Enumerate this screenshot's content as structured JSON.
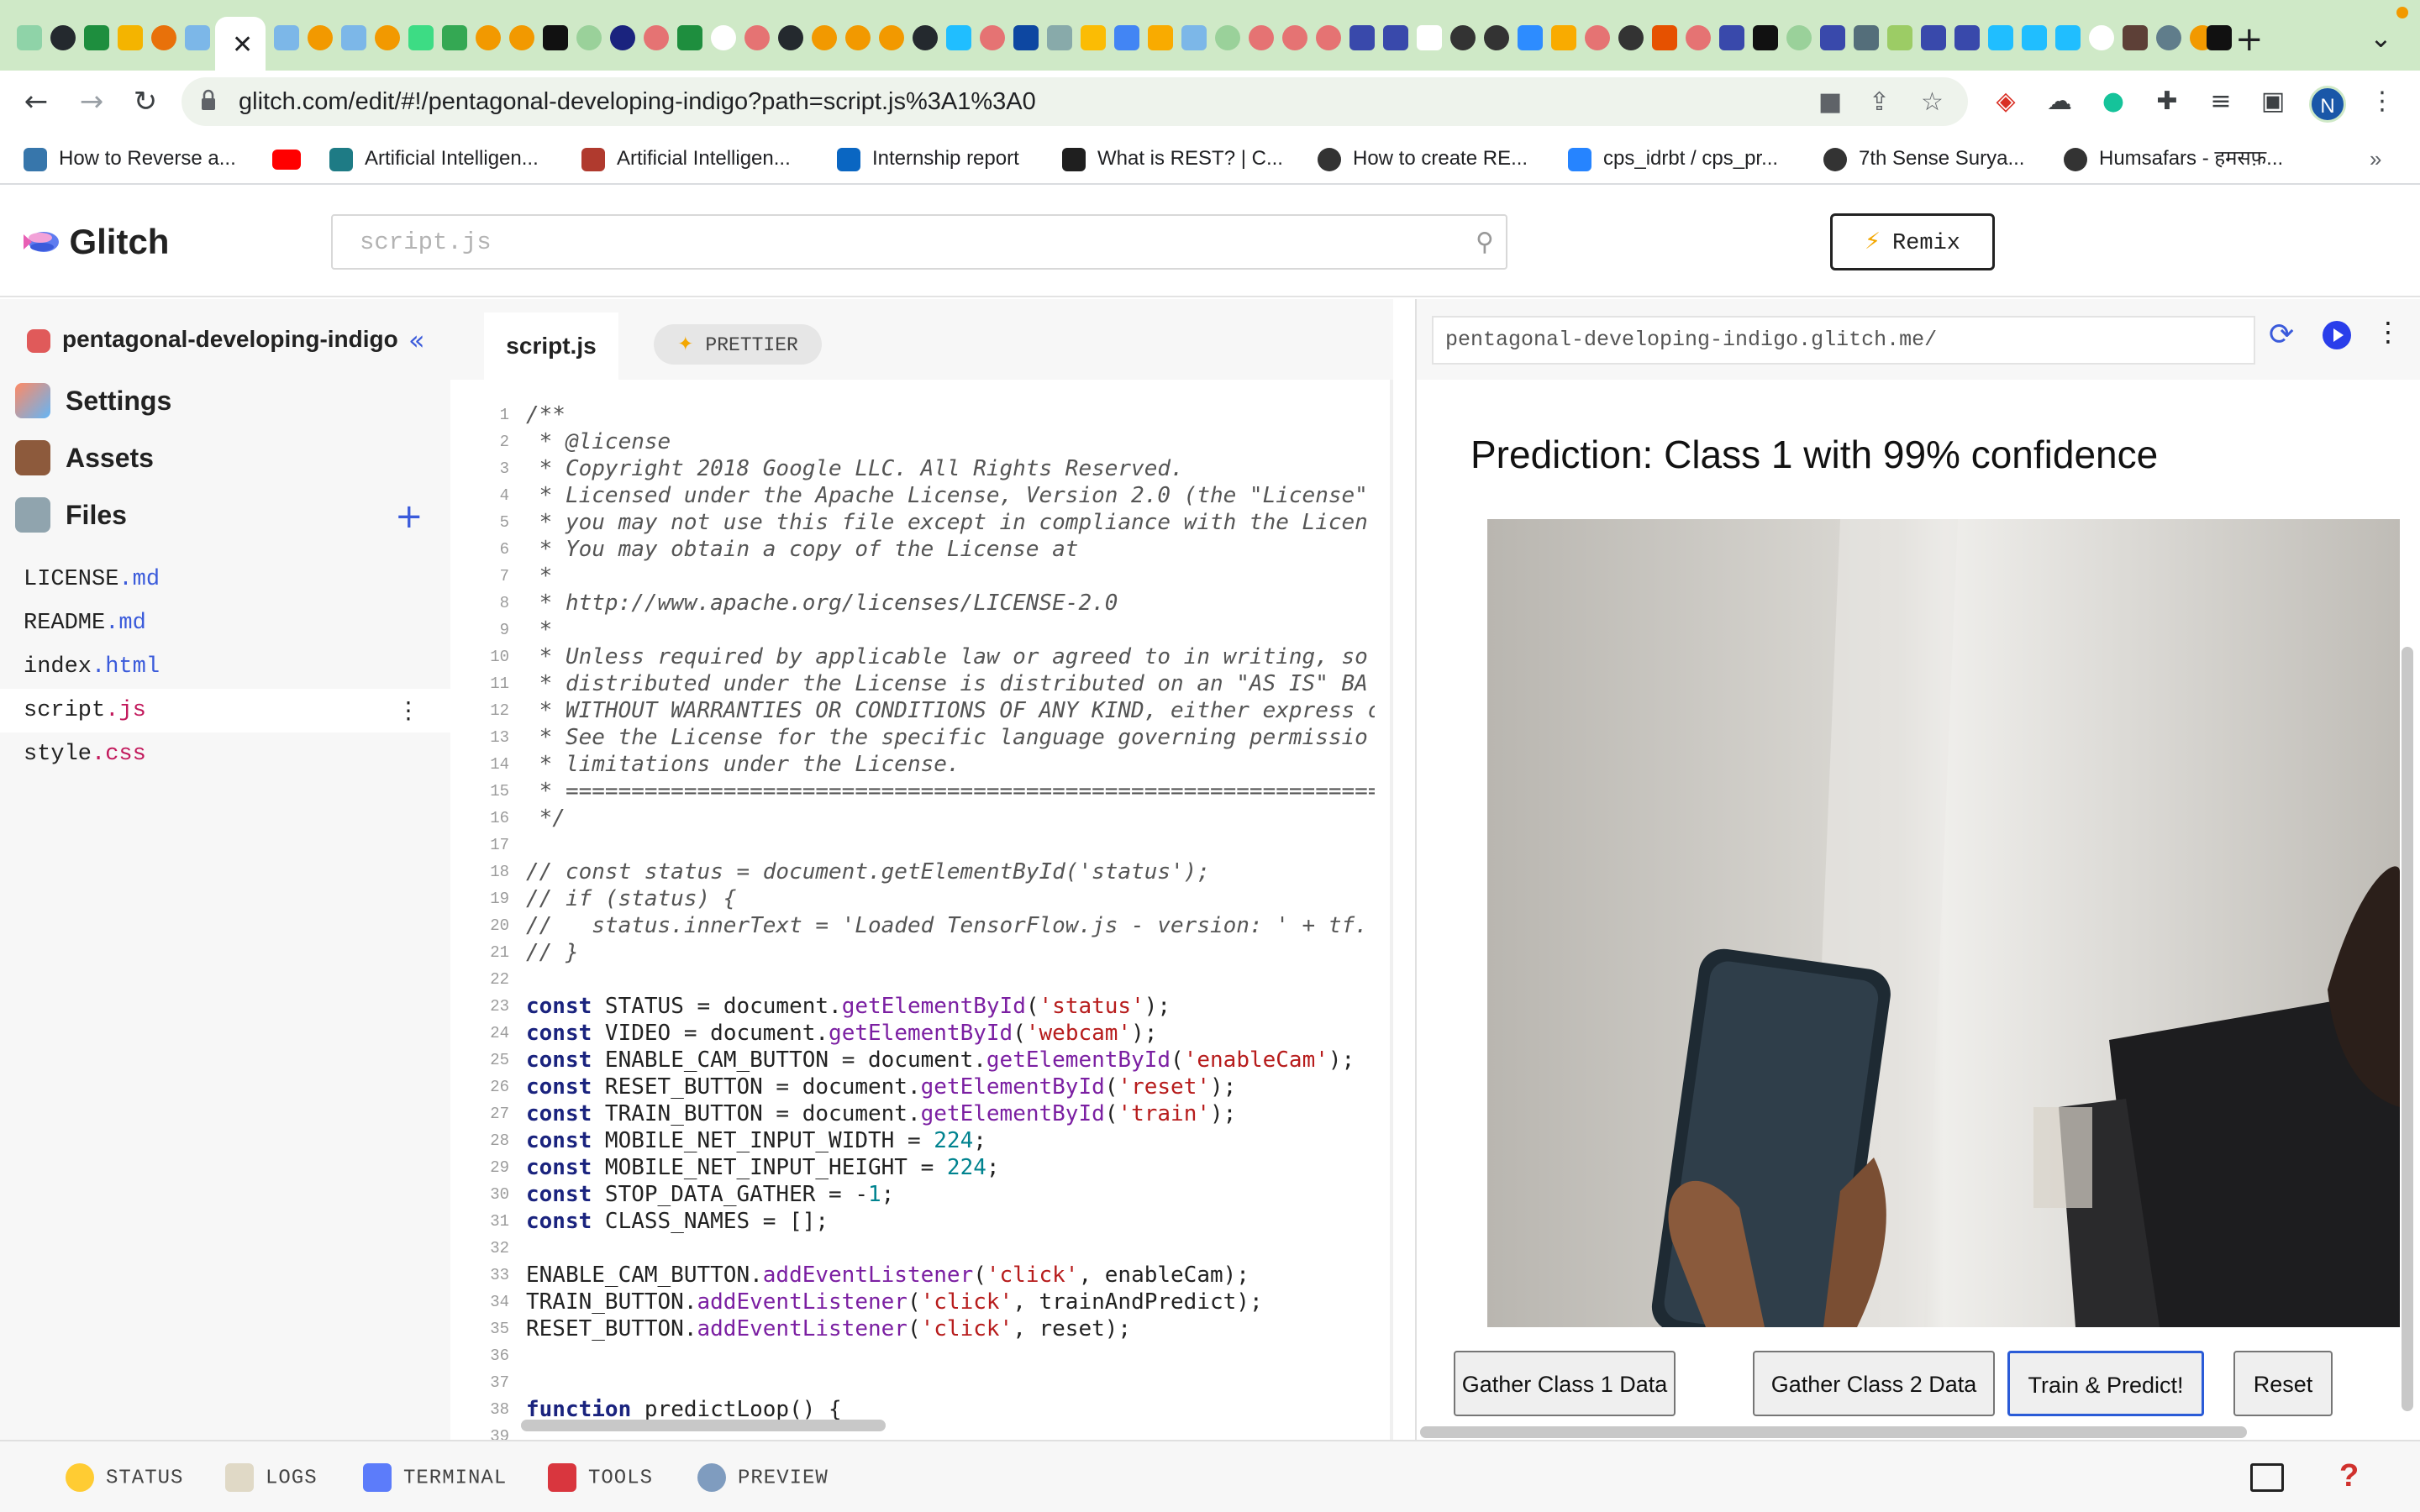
{
  "browser": {
    "active_tab_close": "✕",
    "new_tab": "+",
    "tab_menu": "⌄",
    "url": "glitch.com/edit/#!/pentagonal-developing-indigo?path=script.js%3A1%3A0",
    "profile_initial": "N",
    "bookmarks": [
      {
        "label": "How to Reverse a...",
        "icon": "python-icon",
        "color": "#3776ab"
      },
      {
        "label": "",
        "icon": "youtube-icon",
        "color": "#ff0000"
      },
      {
        "label": "Artificial Intelligen...",
        "icon": "scribd-icon",
        "color": "#1e7b85"
      },
      {
        "label": "Artificial Intelligen...",
        "icon": "notion-icon",
        "color": "#b03a2e"
      },
      {
        "label": "Internship report",
        "icon": "linkedin-icon",
        "color": "#0a66c2"
      },
      {
        "label": "What is REST? | C...",
        "icon": "codecademy-icon",
        "color": "#1f1f1f"
      },
      {
        "label": "How to create RE...",
        "icon": "globe-icon",
        "color": "#333333"
      },
      {
        "label": "cps_idrbt / cps_pr...",
        "icon": "atlassian-icon",
        "color": "#2684ff"
      },
      {
        "label": "7th Sense Surya...",
        "icon": "globe-icon",
        "color": "#333333"
      },
      {
        "label": "Humsafars - हमसफ़...",
        "icon": "globe-icon",
        "color": "#333333"
      }
    ],
    "bookmarks_more": "»"
  },
  "glitch": {
    "logo_text": "Glitch",
    "search_placeholder": "script.js",
    "remix_label": "Remix",
    "remix_icon": "⚡",
    "project_name": "pentagonal-developing-indigo",
    "collapse_icon": "«",
    "nav": [
      {
        "label": "Settings",
        "icon": "settings-icon"
      },
      {
        "label": "Assets",
        "icon": "assets-icon"
      },
      {
        "label": "Files",
        "icon": "files-icon"
      }
    ],
    "add_file": "+",
    "files": [
      {
        "name": "LICENSE",
        "ext": ".md"
      },
      {
        "name": "README",
        "ext": ".md"
      },
      {
        "name": "index",
        "ext": ".html"
      },
      {
        "name": "script",
        "ext": ".js"
      },
      {
        "name": "style",
        "ext": ".css"
      }
    ],
    "file_menu": "⋮"
  },
  "editor": {
    "tab_label": "script.js",
    "prettier_label": "PRETTIER",
    "prettier_icon": "✦",
    "line_numbers": [
      "1",
      "2",
      "3",
      "4",
      "5",
      "6",
      "7",
      "8",
      "9",
      "10",
      "11",
      "12",
      "13",
      "14",
      "15",
      "16",
      "17",
      "18",
      "19",
      "20",
      "21",
      "22",
      "23",
      "24",
      "25",
      "26",
      "27",
      "28",
      "29",
      "30",
      "31",
      "32",
      "33",
      "34",
      "35",
      "36",
      "37",
      "38",
      "39"
    ],
    "fold_marker_1": "⌄",
    "fold_marker_38": "⌄"
  },
  "preview": {
    "url": "pentagonal-developing-indigo.glitch.me/",
    "refresh_icon": "⟳",
    "menu_icon": "⋮",
    "prediction": "Prediction: Class 1 with 99% confidence",
    "buttons": [
      {
        "label": "Gather Class 1 Data"
      },
      {
        "label": "Gather Class 2 Data"
      },
      {
        "label": "Train & Predict!"
      },
      {
        "label": "Reset"
      }
    ]
  },
  "bottom_bar": [
    {
      "label": "STATUS",
      "icon": "smiley-icon"
    },
    {
      "label": "LOGS",
      "icon": "notepad-icon"
    },
    {
      "label": "TERMINAL",
      "icon": "laptop-icon"
    },
    {
      "label": "TOOLS",
      "icon": "toolbox-icon"
    },
    {
      "label": "PREVIEW",
      "icon": "magnifier-icon"
    }
  ],
  "help_label": "?"
}
